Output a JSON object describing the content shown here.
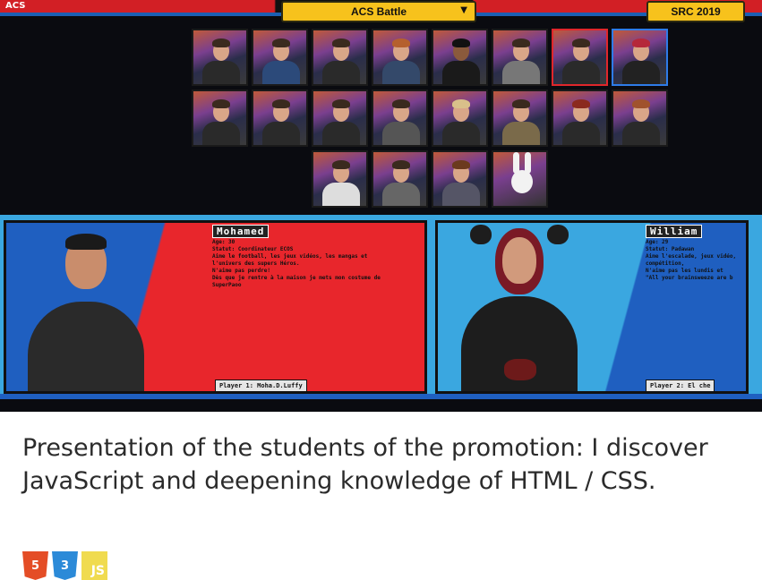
{
  "game": {
    "logo": "ACS",
    "selector_label": "ACS Battle",
    "event_label": "SRC 2019",
    "roster_rows": [
      8,
      8,
      4
    ],
    "player1": {
      "name": "Mohamed",
      "info": "Age: 30\nStatut: Coordinateur ECOS\nAime le football, les jeux vidéos, les mangas et\nl'univers des supers Héros.\nN'aime pas perdre!\nDès que je rentre à la maison je mets mon costume de\nSuperPaoo",
      "tag": "Player 1: Moha.D.Luffy"
    },
    "player2": {
      "name": "William",
      "info": "Age: 29\nStatut: Padawan\nAime l'escalade, jeux vidéo,\ncompétition,\nN'aime pas les lundis et\n\"All your brainsweeze are b",
      "tag": "Player 2: El che"
    }
  },
  "caption": "Presentation of the students of the promotion: I discover JavaScript and deepening knowledge of HTML / CSS.",
  "techs": [
    {
      "name": "html5",
      "glyph": "5",
      "color": "#e44d26"
    },
    {
      "name": "css3",
      "glyph": "3",
      "color": "#2b8ad8"
    },
    {
      "name": "javascript",
      "glyph": "JS",
      "color": "#f0db4f"
    }
  ]
}
